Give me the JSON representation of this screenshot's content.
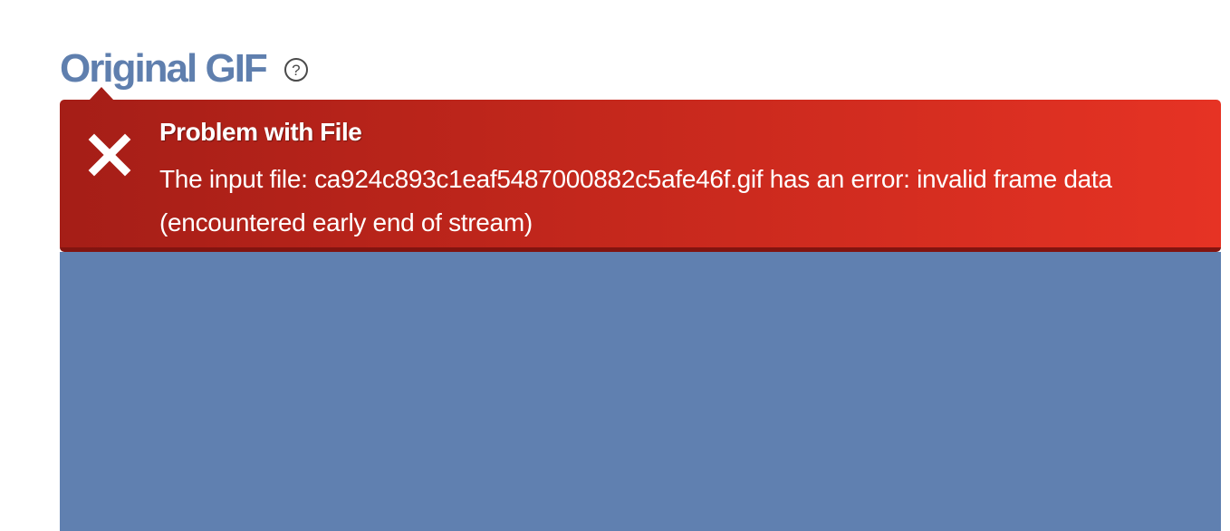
{
  "header": {
    "title": "Original GIF",
    "help_icon": "question-circle-icon",
    "help_symbol": "?"
  },
  "alert": {
    "icon": "close-x-icon",
    "title": "Problem with File",
    "message": "The input file: ca924c893c1eaf5487000882c5afe46f.gif has an error: invalid frame data (encountered early end of stream)",
    "colors": {
      "gradient_start": "#a51e17",
      "gradient_end": "#e63324",
      "text": "#ffffff"
    }
  },
  "preview": {
    "background_color": "#6080b0"
  },
  "colors": {
    "title": "#5f7fae"
  }
}
